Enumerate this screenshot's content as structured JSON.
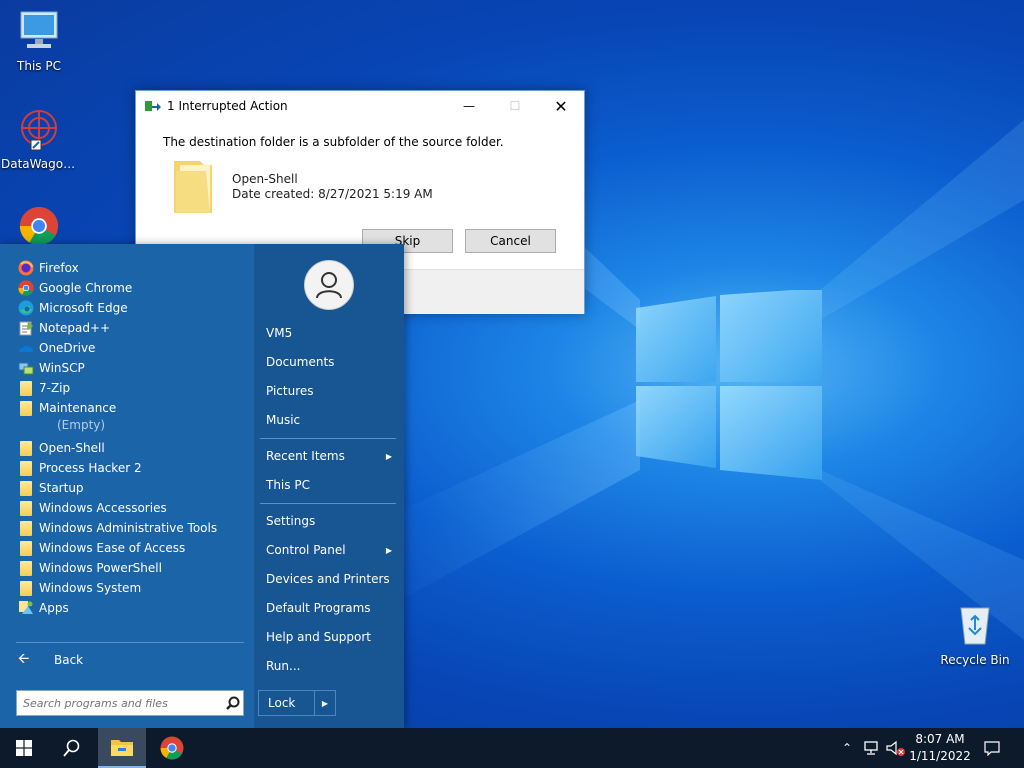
{
  "desktop": {
    "icons": [
      {
        "label": "This PC"
      },
      {
        "label": "DataWagon..."
      },
      {
        "label": "Google Chrome"
      },
      {
        "label": "Recycle Bin"
      }
    ]
  },
  "dialog": {
    "title": "1 Interrupted Action",
    "message": "The destination folder is a subfolder of the source folder.",
    "item_name": "Open-Shell",
    "item_date": "Date created: 8/27/2021 5:19 AM",
    "skip_label": "Skip",
    "cancel_label": "Cancel"
  },
  "start_menu": {
    "programs": [
      {
        "label": "Firefox",
        "icon": "firefox-icon"
      },
      {
        "label": "Google Chrome",
        "icon": "chrome-icon"
      },
      {
        "label": "Microsoft Edge",
        "icon": "edge-icon"
      },
      {
        "label": "Notepad++",
        "icon": "notepadpp-icon"
      },
      {
        "label": "OneDrive",
        "icon": "onedrive-icon"
      },
      {
        "label": "WinSCP",
        "icon": "winscp-icon"
      },
      {
        "label": "7-Zip",
        "icon": "folder-icon"
      },
      {
        "label": "Maintenance",
        "icon": "folder-icon"
      },
      {
        "label": "Open-Shell",
        "icon": "folder-icon"
      },
      {
        "label": "Process Hacker 2",
        "icon": "folder-icon"
      },
      {
        "label": "Startup",
        "icon": "folder-icon"
      },
      {
        "label": "Windows Accessories",
        "icon": "folder-icon"
      },
      {
        "label": "Windows Administrative Tools",
        "icon": "folder-icon"
      },
      {
        "label": "Windows Ease of Access",
        "icon": "folder-icon"
      },
      {
        "label": "Windows PowerShell",
        "icon": "folder-icon"
      },
      {
        "label": "Windows System",
        "icon": "folder-icon"
      },
      {
        "label": "Apps",
        "icon": "apps-icon"
      }
    ],
    "empty_label": "(Empty)",
    "back_label": "Back",
    "search_placeholder": "Search programs and files",
    "right_items": {
      "user": "VM5",
      "documents": "Documents",
      "pictures": "Pictures",
      "music": "Music",
      "recent_items": "Recent Items",
      "this_pc": "This PC",
      "settings": "Settings",
      "control_panel": "Control Panel",
      "devices_printers": "Devices and Printers",
      "default_programs": "Default Programs",
      "help_support": "Help and Support",
      "run": "Run..."
    },
    "lock_label": "Lock"
  },
  "taskbar": {
    "time": "8:07 AM",
    "date": "1/11/2022"
  }
}
